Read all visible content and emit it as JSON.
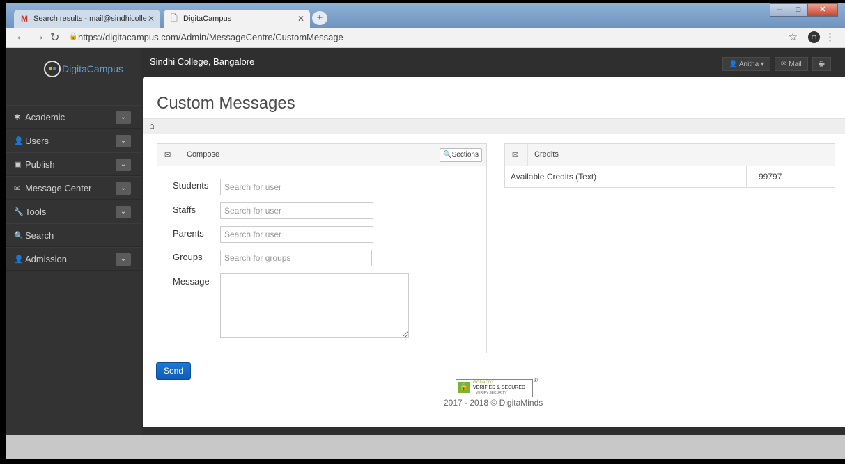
{
  "browser": {
    "tabs": [
      {
        "label": "Search results - mail@sindhicolle",
        "icon": "gmail-icon"
      },
      {
        "label": "DigitaCampus",
        "icon": "page-icon"
      }
    ],
    "url": "https://digitacampus.com/Admin/MessageCentre/CustomMessage",
    "profile_initial": "m"
  },
  "app": {
    "logo_text": "DigitaCampus",
    "college": "Sindhi College, Bangalore",
    "topbar": {
      "user": "Anitha ▾",
      "mail": "Mail"
    },
    "sidebar": {
      "items": [
        {
          "label": "Academic",
          "icon": "asterisk-icon"
        },
        {
          "label": "Users",
          "icon": "user-icon"
        },
        {
          "label": "Publish",
          "icon": "picture-icon"
        },
        {
          "label": "Message Center",
          "icon": "envelope-icon"
        },
        {
          "label": "Tools",
          "icon": "wrench-icon"
        },
        {
          "label": "Search",
          "icon": "search-icon"
        },
        {
          "label": "Admission",
          "icon": "user-icon"
        }
      ]
    }
  },
  "page": {
    "title": "Custom Messages",
    "compose": {
      "header": "Compose",
      "sections_button": "Sections",
      "fields": [
        {
          "label": "Students",
          "placeholder": "Search for user"
        },
        {
          "label": "Staffs",
          "placeholder": "Search for user"
        },
        {
          "label": "Parents",
          "placeholder": "Search for user"
        },
        {
          "label": "Groups",
          "placeholder": "Search for groups"
        }
      ],
      "message_label": "Message"
    },
    "credits": {
      "header": "Credits",
      "row_label": "Available Credits (Text)",
      "row_value": "99797"
    },
    "send_button": "Send",
    "badge": {
      "line1": "GODADDY",
      "line2": "VERIFIED & SECURED",
      "line3": "VERIFY SECURITY"
    },
    "footer": "2017 - 2018 © DigitaMinds"
  },
  "colors": {
    "primary": "#1a78d6",
    "sidebar_bg": "#333333",
    "badge_green": "#7bb42d"
  }
}
